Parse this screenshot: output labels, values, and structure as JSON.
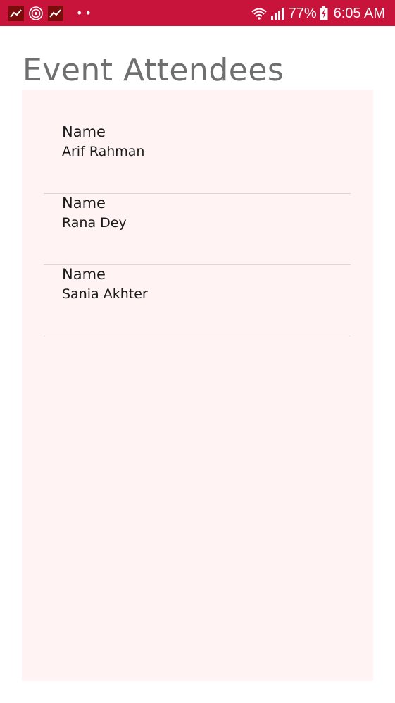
{
  "status_bar": {
    "background": "#c8143a",
    "notification_icons": [
      "stocks-app-icon",
      "spiral-app-icon",
      "stocks-app-icon"
    ],
    "battery_percent": "77%",
    "time": "6:05 AM"
  },
  "page": {
    "title": "Event Attendees"
  },
  "attendees": [
    {
      "label": "Name",
      "value": "Arif Rahman"
    },
    {
      "label": "Name",
      "value": "Rana Dey"
    },
    {
      "label": "Name",
      "value": "Sania Akhter"
    }
  ],
  "colors": {
    "panel_background": "#fff3f3",
    "title_text": "#6f6f6f",
    "divider": "#dcd6d6"
  }
}
